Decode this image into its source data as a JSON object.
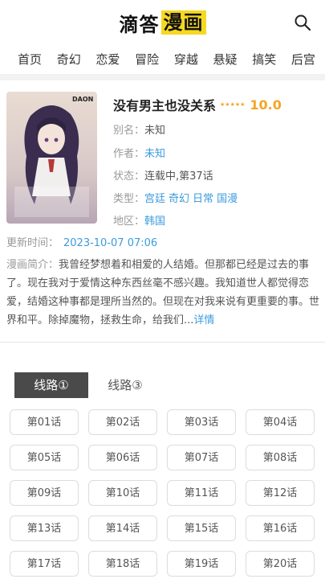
{
  "header": {
    "logo_part1": "滴答",
    "logo_part2": "漫画"
  },
  "nav": [
    "首页",
    "奇幻",
    "恋爱",
    "冒险",
    "穿越",
    "悬疑",
    "搞笑",
    "后宫"
  ],
  "comic": {
    "title": "没有男主也没关系",
    "stars": "★★★★★",
    "score": "10.0",
    "alias_label": "别名：",
    "alias": "未知",
    "author_label": "作者：",
    "author": "未知",
    "status_label": "状态：",
    "status": "连载中,第37话",
    "type_label": "类型：",
    "types": [
      "宫廷",
      "奇幻",
      "日常",
      "国漫"
    ],
    "region_label": "地区：",
    "region": "韩国",
    "cover_text": "DAON",
    "update_label": "更新时间：",
    "update_time": "2023-10-07 07:06",
    "intro_label": "漫画简介：",
    "intro": "我曾经梦想着和相爱的人结婚。但那都已经是过去的事了。现在我对于爱情这种东西丝毫不感兴趣。我知道世人都觉得恋爱，结婚这种事都是理所当然的。但现在对我来说有更重要的事。世界和平。除掉魔物，拯救生命，给我们...",
    "intro_more": "详情"
  },
  "tabs": [
    {
      "label": "线路①",
      "active": true
    },
    {
      "label": "线路③",
      "active": false
    }
  ],
  "chapters": [
    "第01话",
    "第02话",
    "第03话",
    "第04话",
    "第05话",
    "第06话",
    "第07话",
    "第08话",
    "第09话",
    "第10话",
    "第11话",
    "第12话",
    "第13话",
    "第14话",
    "第15话",
    "第16话",
    "第17话",
    "第18话",
    "第19话",
    "第20话"
  ],
  "colors": {
    "accent": "#3b9cdc",
    "score": "#f5a623",
    "logo_highlight": "#f5d821",
    "tab_active": "#4a4a4a"
  },
  "icons": {
    "search": "search-icon"
  }
}
